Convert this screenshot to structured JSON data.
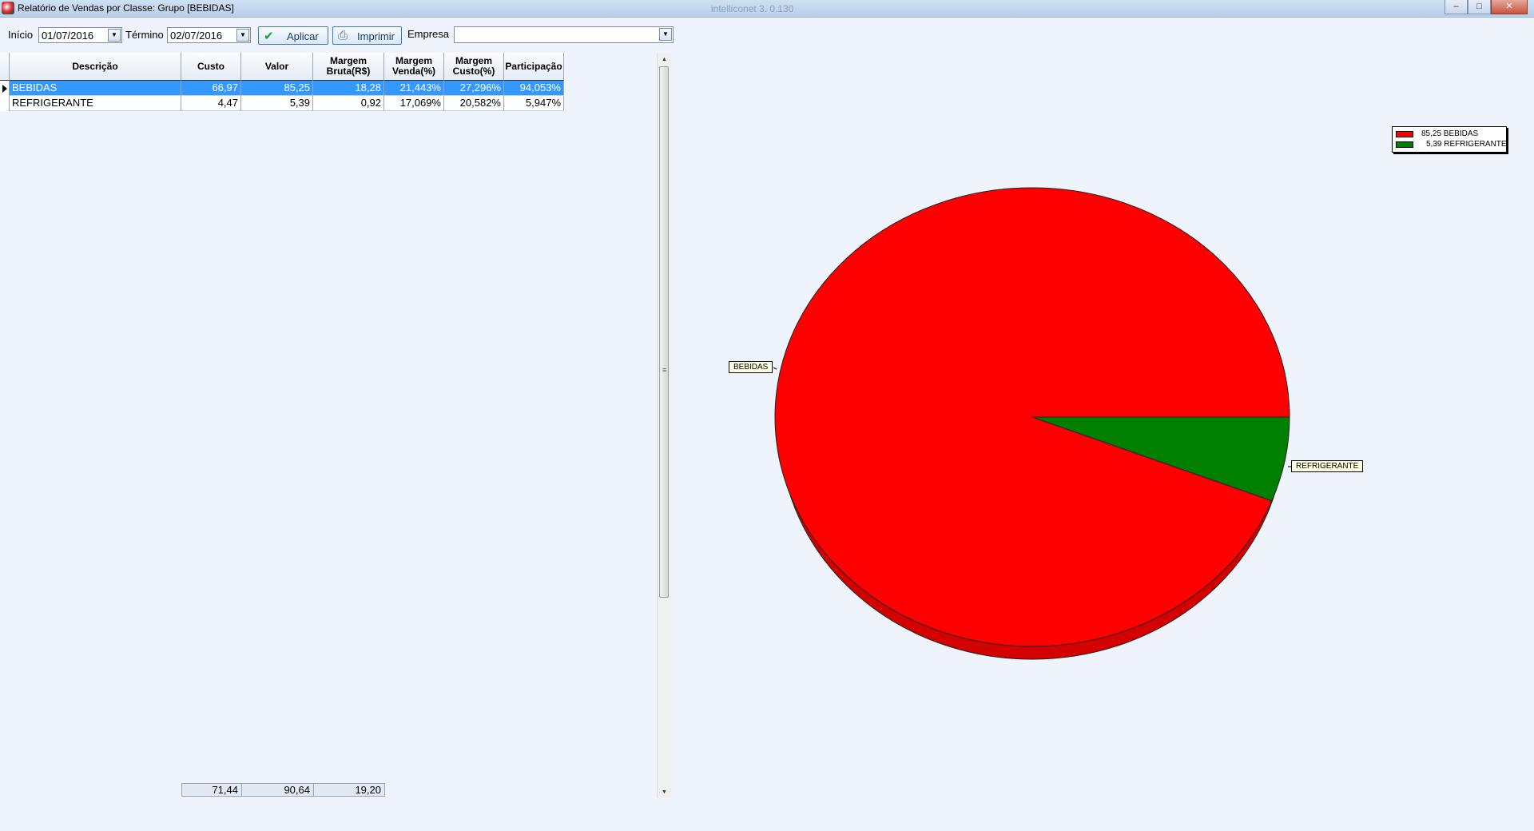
{
  "window": {
    "title": "Relatório de Vendas por Classe: Grupo [BEBIDAS]",
    "center_title": "intelliconet 3. 0.130",
    "controls": [
      "minimize",
      "maximize",
      "close"
    ]
  },
  "filters": {
    "start_label": "Início",
    "start_value": "01/07/2016",
    "end_label": "Término",
    "end_value": "02/07/2016",
    "apply_label": "Aplicar",
    "print_label": "Imprimir",
    "company_label": "Empresa",
    "company_value": ""
  },
  "grid": {
    "columns": [
      "Descrição",
      "Custo",
      "Valor",
      "Margem\nBruta(R$)",
      "Margem\nVenda(%)",
      "Margem\nCusto(%)",
      "Participação"
    ],
    "rows": [
      {
        "descricao": "BEBIDAS",
        "custo": "66,97",
        "valor": "85,25",
        "bruta": "18,28",
        "venda": "21,443%",
        "custo_pct": "27,296%",
        "part": "94,053%",
        "selected": true
      },
      {
        "descricao": "REFRIGERANTE",
        "custo": "4,47",
        "valor": "5,39",
        "bruta": "0,92",
        "venda": "17,069%",
        "custo_pct": "20,582%",
        "part": "5,947%",
        "selected": false
      }
    ],
    "totals": {
      "custo": "71,44",
      "valor": "90,64",
      "bruta": "19,20"
    }
  },
  "chart_data": {
    "type": "pie",
    "categories": [
      "BEBIDAS",
      "REFRIGERANTE"
    ],
    "values": [
      85.25,
      5.39
    ],
    "colors": [
      "#ff0000",
      "#008000"
    ],
    "legend": [
      "85,25 BEBIDAS",
      "5,39 REFRIGERANTE"
    ],
    "slice_labels": [
      "BEBIDAS",
      "REFRIGERANTE"
    ],
    "legend_position": "top-right",
    "title": ""
  }
}
